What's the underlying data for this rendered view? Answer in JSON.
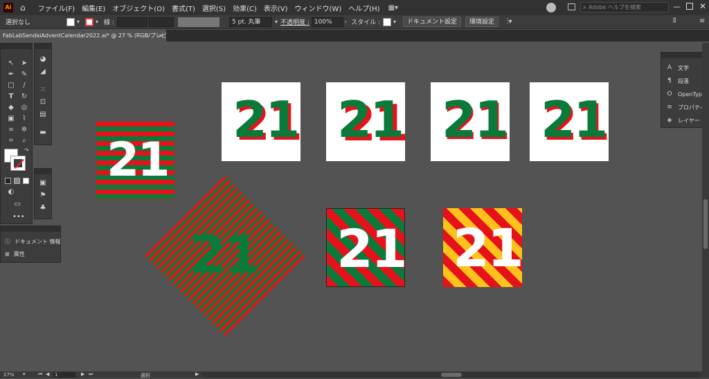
{
  "app": {
    "logo": "Ai",
    "colors": {
      "brand": "#ff9a00",
      "logo_bg": "#330000"
    }
  },
  "menu": [
    "ファイル(F)",
    "編集(E)",
    "オブジェクト(O)",
    "書式(T)",
    "選択(S)",
    "効果(C)",
    "表示(V)",
    "ウィンドウ(W)",
    "ヘルプ(H)"
  ],
  "search": {
    "placeholder": "Adobe ヘルプを検索"
  },
  "control": {
    "selection": "選択なし",
    "stroke_label": "線 :",
    "brush": "5 pt. 丸筆",
    "opacity_label": "不透明度 :",
    "opacity_value": "100%",
    "style_label": "スタイル :",
    "doc_setup": "ドキュメント設定",
    "preferences": "環境設定"
  },
  "tab": {
    "title": "FabLabSendaiAdventCalendar2022.ai* @ 27 % (RGB/プレビュー)",
    "close": "×"
  },
  "artwork": {
    "number": "21",
    "colors": {
      "green": "#0a7a3a",
      "red": "#e6121b",
      "white": "#ffffff",
      "yellow": "#ffc21a",
      "canvas": "#535353"
    }
  },
  "right_panel": {
    "items": [
      {
        "icon": "A",
        "label": "文字"
      },
      {
        "icon": "¶",
        "label": "段落"
      },
      {
        "icon": "O",
        "label": "OpenType"
      },
      {
        "icon": "≡",
        "label": "プロパティ"
      },
      {
        "icon": "◈",
        "label": "レイヤー"
      }
    ]
  },
  "left_panel": {
    "items": [
      {
        "icon": "ⓘ",
        "label": "ドキュメント 情報"
      },
      {
        "icon": "⊞",
        "label": "属性"
      }
    ]
  },
  "status": {
    "zoom": "27%",
    "page": "1",
    "tool": "選択"
  }
}
